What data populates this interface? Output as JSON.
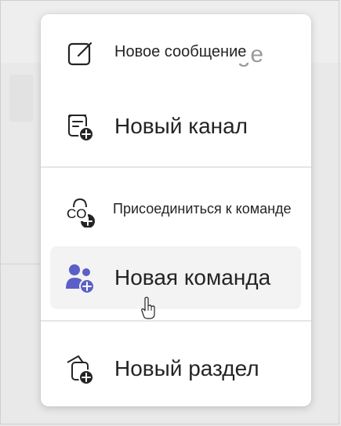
{
  "menu": {
    "items": [
      {
        "label": "Новое сообщение",
        "ghost": "New message",
        "icon": "compose-icon"
      },
      {
        "label": "Новый канал",
        "icon": "channel-add-icon"
      },
      {
        "label": "Присоединиться к команде",
        "icon_text": "CO",
        "icon": "team-join-icon"
      },
      {
        "label": "Новая команда",
        "icon": "new-team-icon"
      },
      {
        "label": "Новый раздел",
        "icon": "new-section-icon"
      }
    ]
  },
  "colors": {
    "accent": "#5b5fc7",
    "text": "#242424",
    "hover": "#f3f3f3"
  }
}
